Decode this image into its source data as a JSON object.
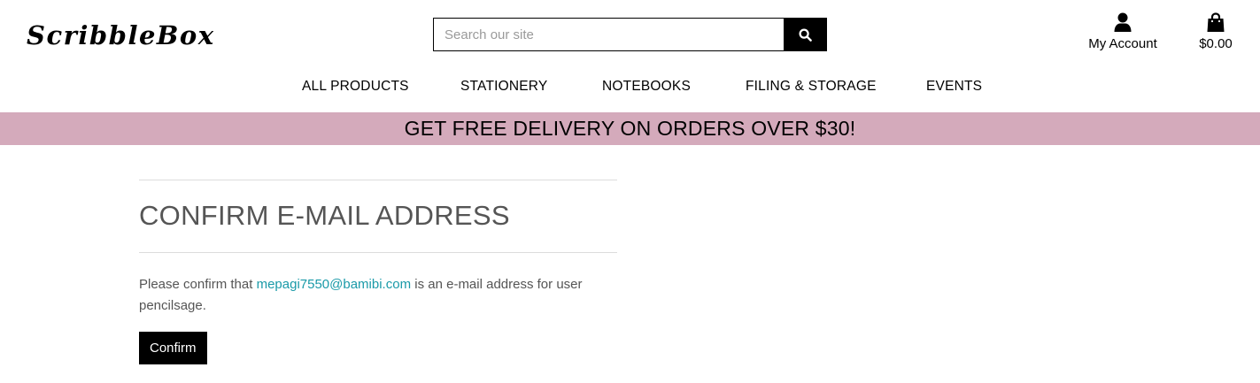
{
  "header": {
    "logo_text": "ScribbleBox",
    "search": {
      "placeholder": "Search our site",
      "value": ""
    },
    "account_label": "My Account",
    "cart_total": "$0.00"
  },
  "nav": {
    "items": [
      "ALL PRODUCTS",
      "STATIONERY",
      "NOTEBOOKS",
      "FILING & STORAGE",
      "EVENTS"
    ]
  },
  "banner": {
    "text": "GET FREE DELIVERY ON ORDERS OVER $30!"
  },
  "main": {
    "title": "CONFIRM E-MAIL ADDRESS",
    "message_prefix": "Please confirm that",
    "email": "mepagi7550@bamibi.com",
    "message_suffix": "is an e-mail address for user pencilsage.",
    "confirm_label": "Confirm"
  },
  "colors": {
    "banner_bg": "#d4aabb",
    "link": "#1a9aa8",
    "button_bg": "#000000"
  },
  "icons": [
    "search-icon",
    "user-icon",
    "shopping-bag-icon"
  ]
}
